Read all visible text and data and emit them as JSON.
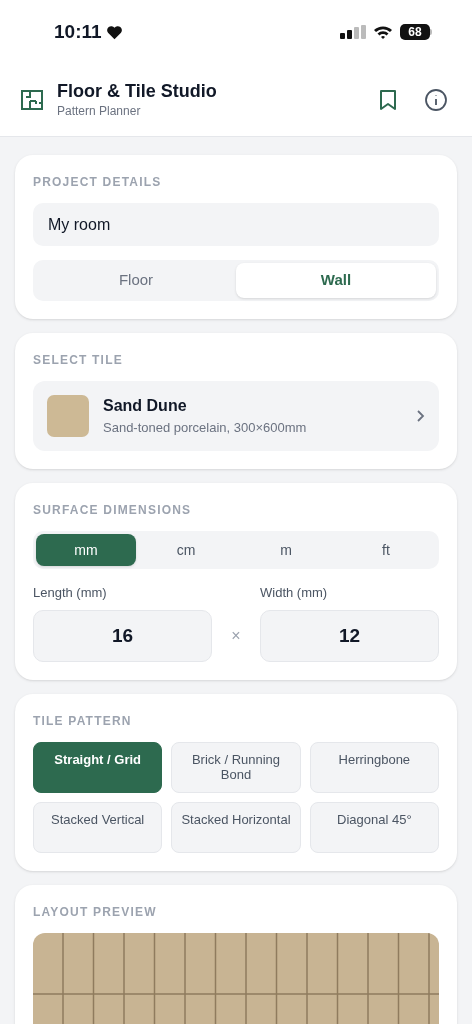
{
  "status_bar": {
    "time": "10:11",
    "battery": "68"
  },
  "header": {
    "title": "Floor & Tile Studio",
    "subtitle": "Pattern Planner"
  },
  "project": {
    "heading": "PROJECT DETAILS",
    "name_value": "My room",
    "surfaces": [
      {
        "label": "Floor",
        "selected": false
      },
      {
        "label": "Wall",
        "selected": true
      }
    ]
  },
  "tile": {
    "heading": "SELECT TILE",
    "name": "Sand Dune",
    "description": "Sand-toned porcelain, 300×600mm"
  },
  "dimensions": {
    "heading": "SURFACE DIMENSIONS",
    "units": [
      {
        "label": "mm",
        "selected": true
      },
      {
        "label": "cm",
        "selected": false
      },
      {
        "label": "m",
        "selected": false
      },
      {
        "label": "ft",
        "selected": false
      }
    ],
    "length_label": "Length (mm)",
    "length_value": "16",
    "times": "×",
    "width_label": "Width (mm)",
    "width_value": "12"
  },
  "pattern": {
    "heading": "TILE PATTERN",
    "options": [
      {
        "label": "Straight / Grid",
        "selected": true
      },
      {
        "label": "Brick / Running Bond",
        "selected": false
      },
      {
        "label": "Herringbone",
        "selected": false
      },
      {
        "label": "Stacked Vertical",
        "selected": false
      },
      {
        "label": "Stacked Horizontal",
        "selected": false
      },
      {
        "label": "Diagonal 45°",
        "selected": false
      }
    ]
  },
  "preview": {
    "heading": "LAYOUT PREVIEW"
  }
}
